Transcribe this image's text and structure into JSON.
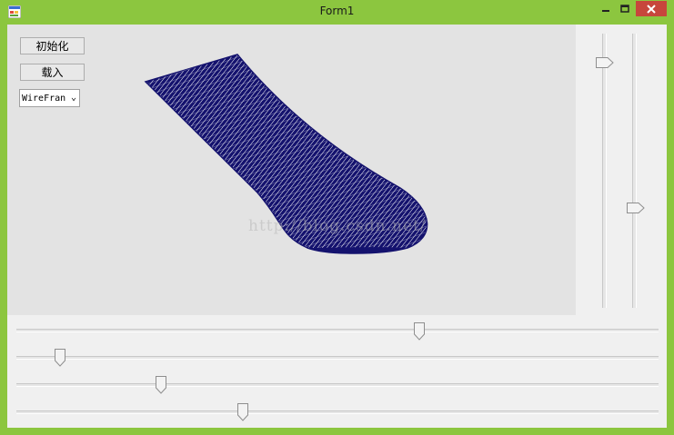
{
  "window": {
    "title": "Form1"
  },
  "controls": {
    "init_button": "初始化",
    "load_button": "载入",
    "render_mode": "WireFran"
  },
  "viewport": {
    "watermark": "http://blog.csdn.net/"
  },
  "sliders": {
    "vertical": [
      0.09,
      0.64
    ],
    "horizontal": [
      0.63,
      0.06,
      0.22,
      0.35
    ]
  }
}
